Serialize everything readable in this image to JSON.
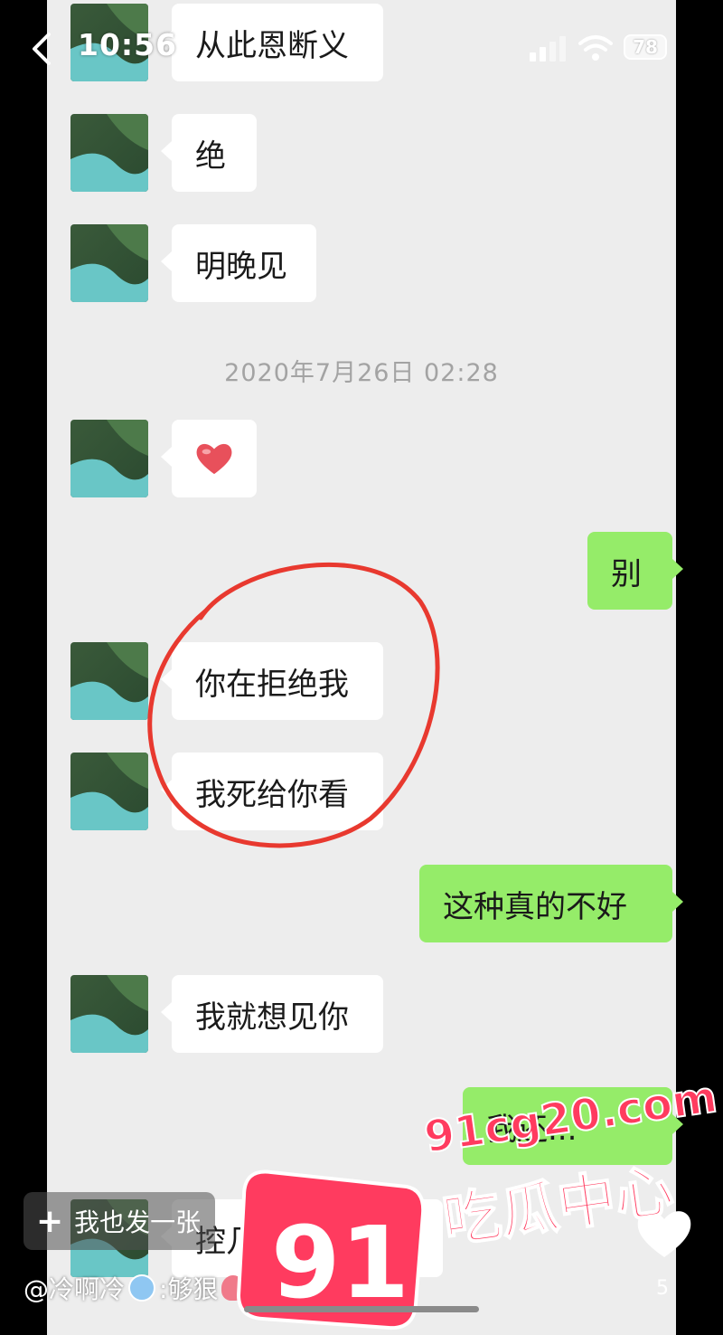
{
  "status_bar": {
    "time": "10:56",
    "battery": "78"
  },
  "timestamp": "2020年7月26日 02:28",
  "messages": [
    {
      "side": "left",
      "text": "从此恩断义"
    },
    {
      "side": "left",
      "text": "绝"
    },
    {
      "side": "left",
      "text": "明晚见"
    },
    {
      "side": "left",
      "emoji": "heart-emoji"
    },
    {
      "side": "right",
      "text": "别"
    },
    {
      "side": "left",
      "text": "你在拒绝我"
    },
    {
      "side": "left",
      "text": "我死给你看"
    },
    {
      "side": "right",
      "text": "这种真的不好"
    },
    {
      "side": "left",
      "text": "我就想见你"
    },
    {
      "side": "right",
      "text": "我还..."
    },
    {
      "side": "left",
      "text": "控几不住我自己"
    }
  ],
  "overlay": {
    "post_button": "我也发一张",
    "comment_user": "@冷啊冷",
    "comment_text": ":够狠",
    "like_count": "5"
  },
  "watermark": {
    "url": "91cg20.com",
    "number": "91",
    "name": "吃瓜中心"
  },
  "colors": {
    "chat_bg": "#ededed",
    "sent_bubble": "#95ec69",
    "circle": "#e8392f",
    "watermark": "#ff3b5f"
  }
}
